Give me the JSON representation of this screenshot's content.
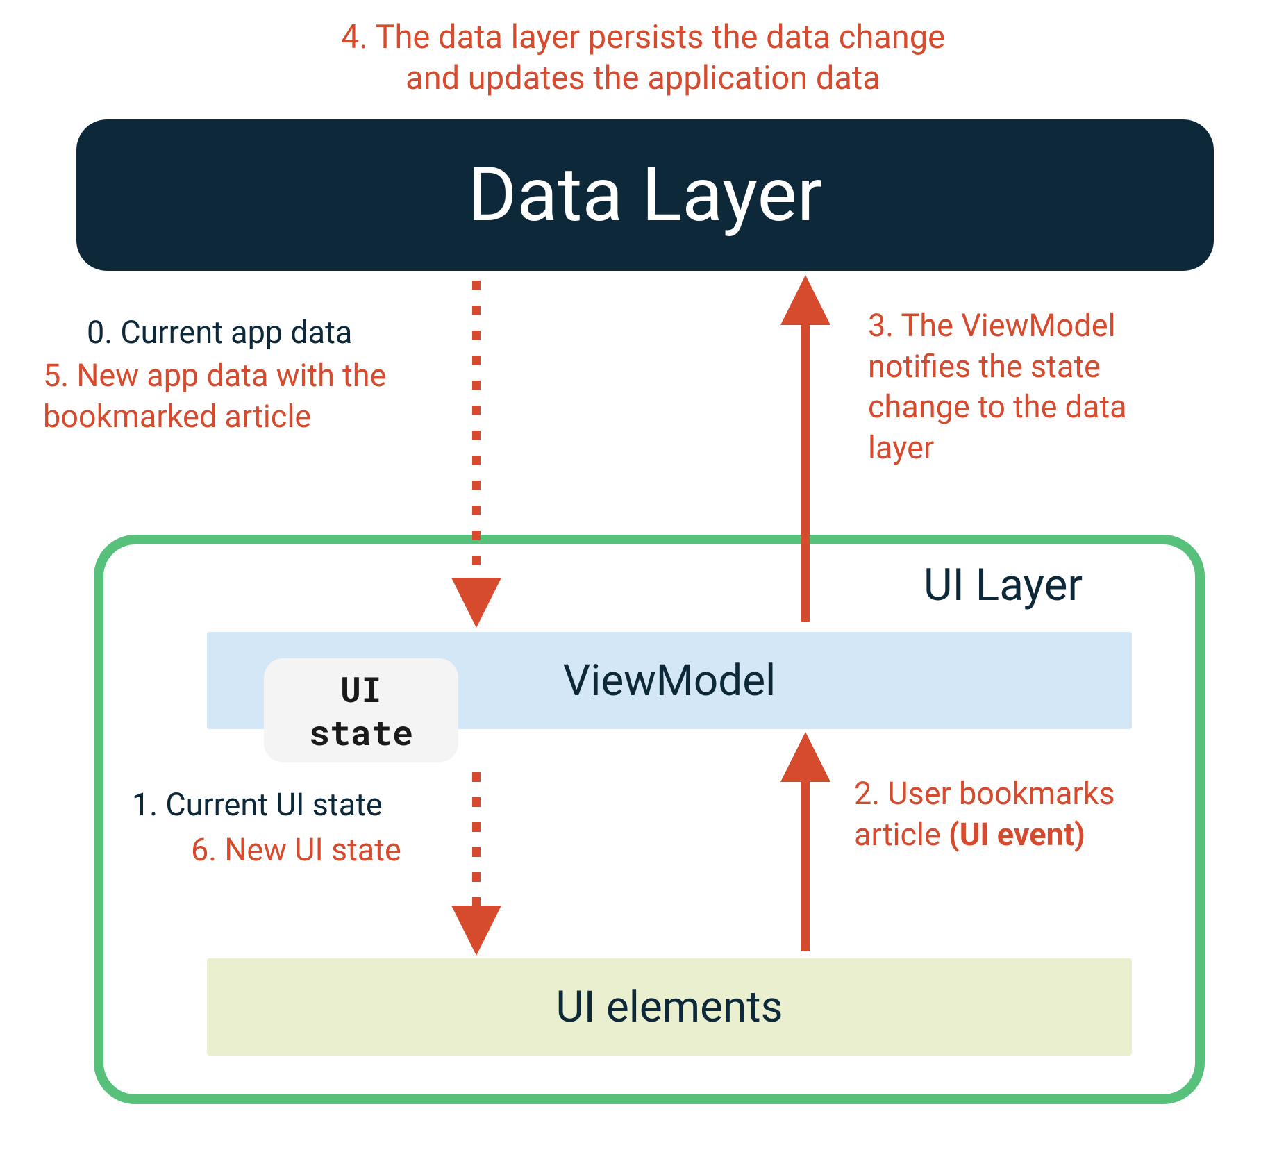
{
  "annotations": {
    "top": "4. The data layer persists the data change\nand updates the application data",
    "step0": "0. Current app data",
    "step5": "5. New app data with the bookmarked article",
    "step3": "3. The ViewModel notifies the state change to the data layer",
    "step1": "1. Current UI state",
    "step6": "6. New UI state",
    "step2_prefix": "2. User bookmarks article ",
    "step2_bold": "(UI event)"
  },
  "boxes": {
    "data_layer": "Data Layer",
    "ui_layer": "UI Layer",
    "view_model": "ViewModel",
    "ui_state": "UI\nstate",
    "ui_elements": "UI elements"
  },
  "colors": {
    "accent": "#d64b2e",
    "dark": "#0c2839",
    "green": "#57c17b",
    "vm_bg": "#d4e7f7",
    "ue_bg": "#eaf0cf"
  }
}
